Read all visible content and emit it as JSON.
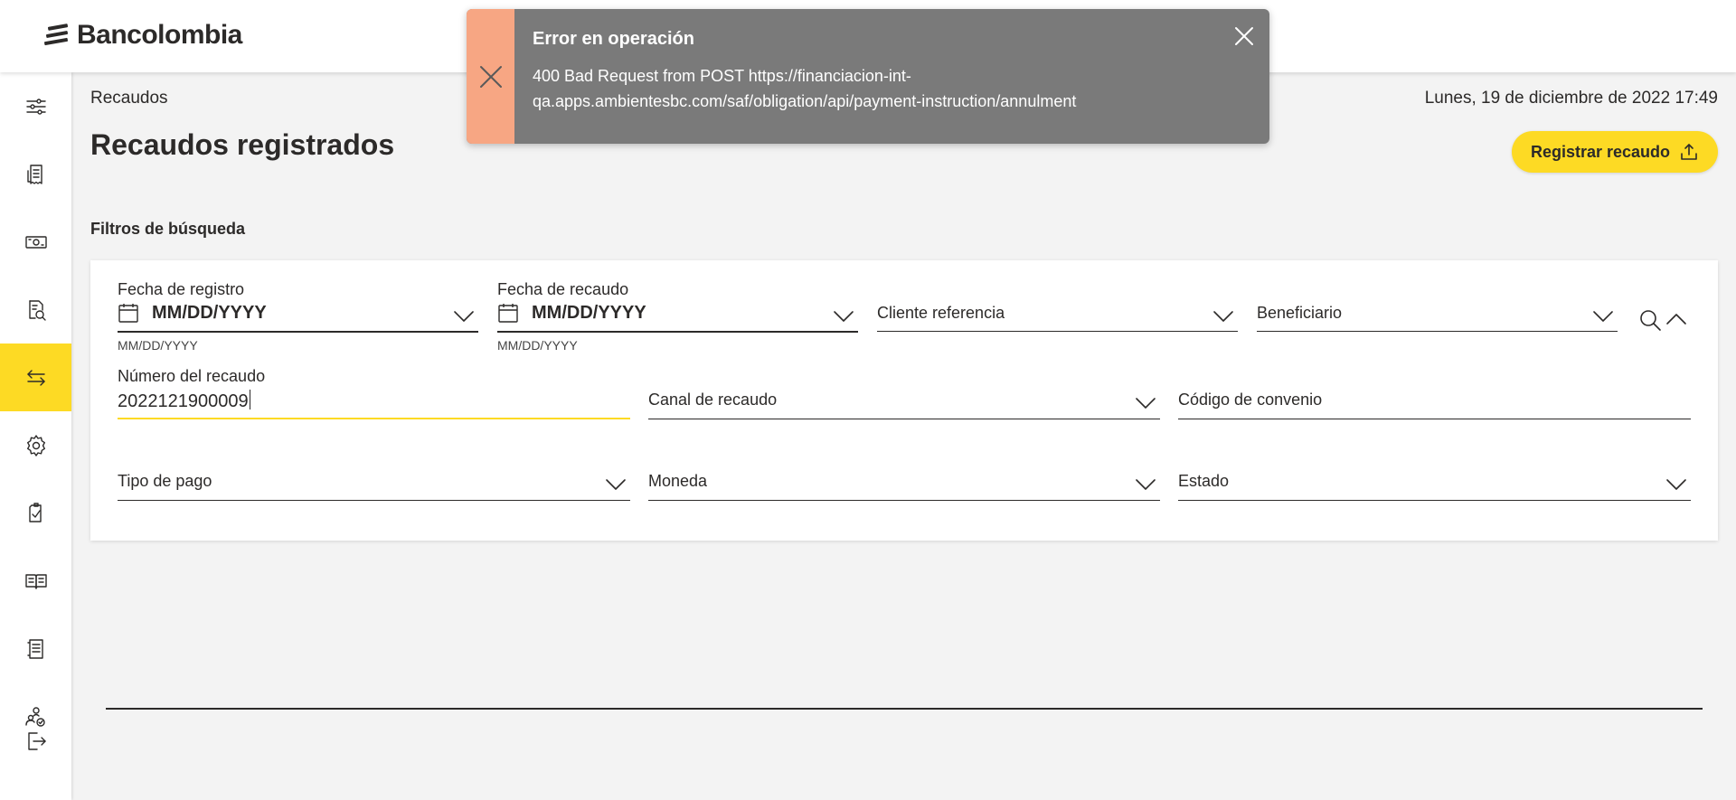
{
  "brand": {
    "name": "Bancolombia",
    "accent_color": "#fdda24",
    "text_color": "#2c2a29"
  },
  "sidebar": {
    "items": [
      {
        "icon": "sliders-icon"
      },
      {
        "icon": "receipt-icon"
      },
      {
        "icon": "money-icon"
      },
      {
        "icon": "document-search-icon"
      },
      {
        "icon": "transfer-icon",
        "active": true
      },
      {
        "icon": "gear-icon"
      },
      {
        "icon": "document-check-icon"
      },
      {
        "icon": "book-icon"
      },
      {
        "icon": "notebook-icon"
      },
      {
        "icon": "users-check-icon"
      },
      {
        "icon": "logout-icon"
      }
    ]
  },
  "header": {
    "breadcrumb": "Recaudos",
    "datetime": "Lunes, 19 de diciembre de 2022 17:49",
    "title": "Recaudos registrados",
    "register_button": "Registrar recaudo"
  },
  "filters": {
    "section_title": "Filtros de búsqueda",
    "fecha_registro": {
      "label": "Fecha de registro",
      "value": "MM/DD/YYYY",
      "hint": "MM/DD/YYYY"
    },
    "fecha_recaudo": {
      "label": "Fecha de recaudo",
      "value": "MM/DD/YYYY",
      "hint": "MM/DD/YYYY"
    },
    "cliente_referencia": {
      "placeholder": "Cliente referencia"
    },
    "beneficiario": {
      "placeholder": "Beneficiario"
    },
    "numero_recaudo": {
      "label": "Número del recaudo",
      "value": "2022121900009"
    },
    "canal_recaudo": {
      "placeholder": "Canal de recaudo"
    },
    "codigo_convenio": {
      "placeholder": "Código de convenio"
    },
    "tipo_pago": {
      "placeholder": "Tipo de pago"
    },
    "moneda": {
      "placeholder": "Moneda"
    },
    "estado": {
      "placeholder": "Estado"
    }
  },
  "toast": {
    "title": "Error en operación",
    "message": "400 Bad Request from POST https://financiacion-int-qa.apps.ambientesbc.com/saf/obligation/api/payment-instruction/annulment",
    "color": "#7a7a7a",
    "side_color": "#f7a683"
  }
}
